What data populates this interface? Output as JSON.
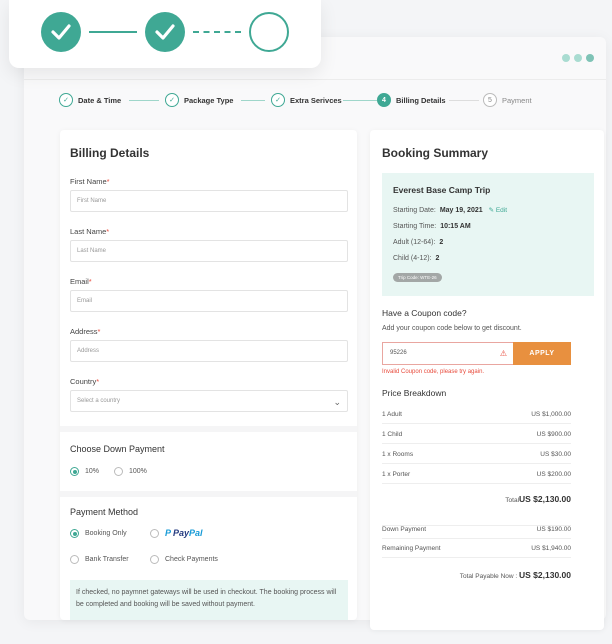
{
  "stepper": {
    "steps": [
      {
        "label": "Date & Time",
        "status": "done"
      },
      {
        "label": "Package Type",
        "status": "done"
      },
      {
        "label": "Extra Serivces",
        "status": "done"
      },
      {
        "label": "Billing Details",
        "status": "active",
        "number": "4"
      },
      {
        "label": "Payment",
        "status": "pending",
        "number": "5"
      }
    ]
  },
  "billing": {
    "title": "Billing Details",
    "first_name": {
      "label": "First Name",
      "placeholder": "First Name"
    },
    "last_name": {
      "label": "Last Name",
      "placeholder": "Last Name"
    },
    "email": {
      "label": "Email",
      "placeholder": "Email"
    },
    "address": {
      "label": "Address",
      "placeholder": "Address"
    },
    "country": {
      "label": "Country",
      "placeholder": "Select a country"
    },
    "required_mark": "*",
    "down_payment": {
      "title": "Choose Down Payment",
      "options": [
        "10%",
        "100%"
      ],
      "selected": "10%"
    },
    "payment_method": {
      "title": "Payment Method",
      "options": [
        "Booking Only",
        "PayPal",
        "Bank Transfer",
        "Check Payments"
      ],
      "selected": "Booking Only",
      "paypal_logo": {
        "pay": "Pay",
        "pal": "Pal"
      }
    },
    "notice": "If checked, no paymnet gateways will be used in checkout. The booking process will be completed and booking will be saved without payment."
  },
  "summary": {
    "title": "Booking Summary",
    "trip": {
      "name": "Everest Base Camp Trip",
      "starting_date_label": "Starting Date:",
      "starting_date": "May 19, 2021",
      "edit_label": "Edit",
      "starting_time_label": "Starting Time:",
      "starting_time": "10:15 AM",
      "adult_label": "Adult (12-64):",
      "adult_count": "2",
      "child_label": "Child (4-12):",
      "child_count": "2",
      "trip_code": "Trip Code: WTE-26"
    },
    "coupon": {
      "title": "Have a Coupon code?",
      "subtitle": "Add your coupon code below to get discount.",
      "value": "95226",
      "button": "APPLY",
      "error": "Invalid Coupon code, please try again."
    },
    "price_breakdown": {
      "title": "Price Breakdown",
      "rows": [
        {
          "label": "1 Adult",
          "value": "US $1,000.00"
        },
        {
          "label": "1 Child",
          "value": "US $900.00"
        },
        {
          "label": "1 x Rooms",
          "value": "US $30.00"
        },
        {
          "label": "1 x Porter",
          "value": "US $200.00"
        }
      ],
      "total_label": "Total",
      "total_value": "US $2,130.00",
      "down_payment_label": "Down Payment",
      "down_payment_value": "US $190.00",
      "remaining_label": "Remaining Payment",
      "remaining_value": "US $1,940.00",
      "payable_label": "Total Payable Now : ",
      "payable_value": "US $2,130.00"
    }
  },
  "colors": {
    "accent": "#3fa894",
    "apply": "#e8903f",
    "error": "#e84c3d"
  }
}
